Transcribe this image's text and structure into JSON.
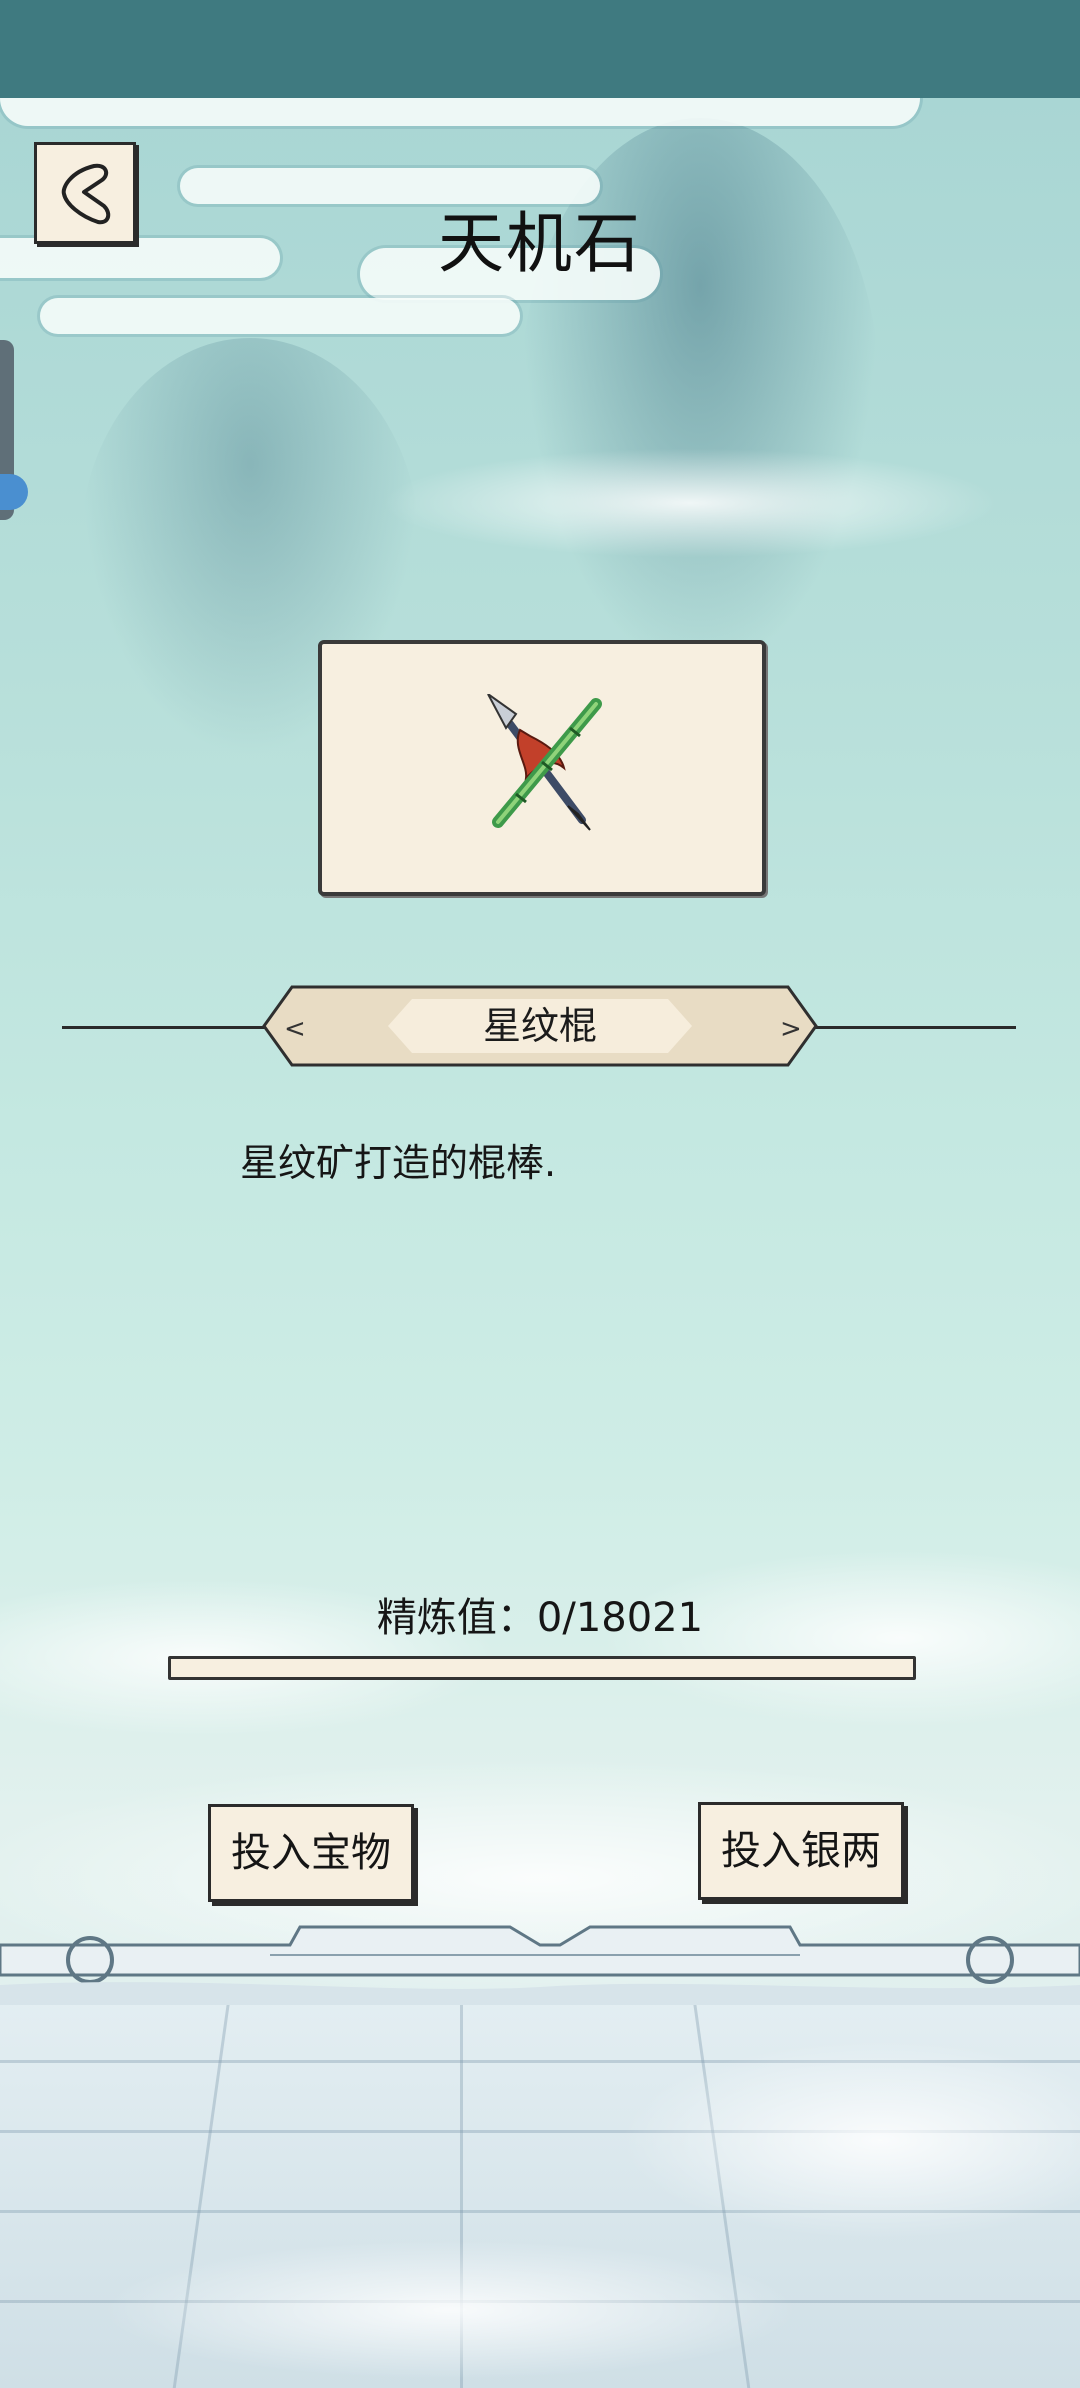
{
  "header": {
    "title": "天机石"
  },
  "item": {
    "name": "星纹棍",
    "description": "星纹矿打造的棍棒."
  },
  "refine": {
    "label": "精炼值：0/18021",
    "current": 0,
    "max": 18021,
    "progress_fraction": 0
  },
  "actions": {
    "invest_treasure": "投入宝物",
    "invest_silver": "投入银两"
  },
  "colors": {
    "paper": "#f7efe0",
    "ink": "#2b2b2b",
    "statusbar": "#3f7a80",
    "sky": "#bfe3de"
  }
}
